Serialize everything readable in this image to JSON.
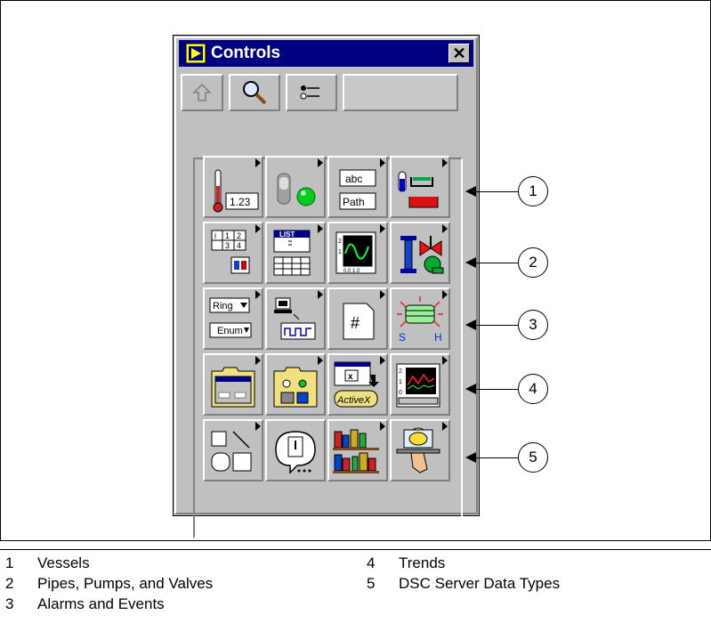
{
  "window": {
    "title": "Controls",
    "close_glyph": "✕"
  },
  "toolbar": {
    "buttons": [
      {
        "name": "up-arrow-icon"
      },
      {
        "name": "search-icon"
      },
      {
        "name": "options-icon"
      }
    ]
  },
  "palette": {
    "rows": [
      [
        {
          "name": "numeric-controls",
          "text": "1.23"
        },
        {
          "name": "boolean-controls"
        },
        {
          "name": "string-path-controls",
          "text1": "abc",
          "text2": "Path"
        },
        {
          "name": "vessels-controls"
        }
      ],
      [
        {
          "name": "array-cluster-controls",
          "text": "1 1 2\n  3 4"
        },
        {
          "name": "list-table-controls",
          "text": "LIST"
        },
        {
          "name": "graph-controls",
          "text": "0.0 1.0"
        },
        {
          "name": "pipes-pumps-valves-controls"
        }
      ],
      [
        {
          "name": "ring-enum-controls",
          "text1": "Ring",
          "text2": "Enum"
        },
        {
          "name": "io-controls"
        },
        {
          "name": "refnum-controls",
          "text": "#"
        },
        {
          "name": "alarms-events-controls",
          "text1": "S",
          "text2": "H"
        }
      ],
      [
        {
          "name": "dialog-controls"
        },
        {
          "name": "classic-controls"
        },
        {
          "name": "activex-controls",
          "text": "ActiveX"
        },
        {
          "name": "trends-controls"
        }
      ],
      [
        {
          "name": "decorations"
        },
        {
          "name": "select-control"
        },
        {
          "name": "user-libraries"
        },
        {
          "name": "dsc-server-data-types"
        }
      ]
    ]
  },
  "callouts": [
    "1",
    "2",
    "3",
    "4",
    "5"
  ],
  "legend": [
    {
      "num": "1",
      "label": "Vessels"
    },
    {
      "num": "2",
      "label": "Pipes, Pumps, and Valves"
    },
    {
      "num": "3",
      "label": "Alarms and Events"
    },
    {
      "num": "4",
      "label": "Trends"
    },
    {
      "num": "5",
      "label": "DSC Server Data Types"
    }
  ]
}
